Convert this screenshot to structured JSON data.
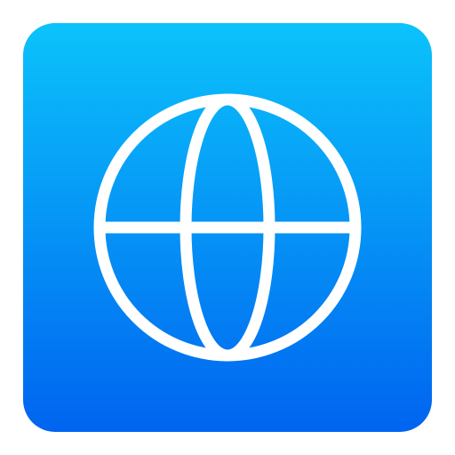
{
  "icon": {
    "name": "globe-icon",
    "gradient_top": "#0BC3FB",
    "gradient_bottom": "#0064F0",
    "stroke_color": "#FFFFFF"
  }
}
